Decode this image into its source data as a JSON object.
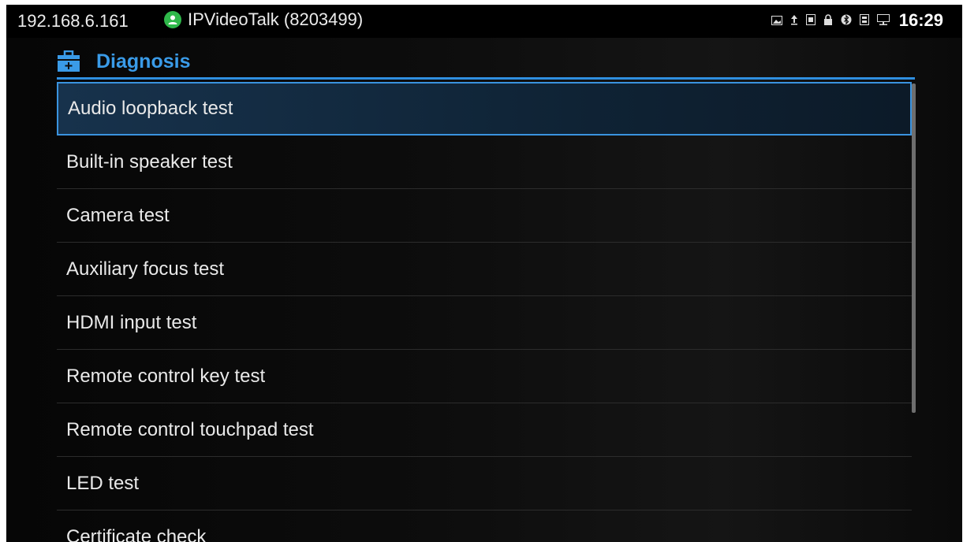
{
  "status_bar": {
    "ip": "192.168.6.161",
    "account": "IPVideoTalk (8203499)",
    "time": "16:29",
    "icons": [
      "image-icon",
      "upload-icon",
      "sim-icon",
      "lock-icon",
      "bluetooth-icon",
      "storage-icon",
      "network-icon"
    ]
  },
  "page": {
    "title": "Diagnosis",
    "accent_color": "#3a9be8"
  },
  "items": [
    {
      "label": "Audio loopback test",
      "selected": true
    },
    {
      "label": "Built-in speaker test"
    },
    {
      "label": "Camera test"
    },
    {
      "label": "Auxiliary focus test"
    },
    {
      "label": "HDMI input test"
    },
    {
      "label": "Remote control key test"
    },
    {
      "label": "Remote control touchpad test"
    },
    {
      "label": "LED test"
    },
    {
      "label": "Certificate check"
    }
  ]
}
